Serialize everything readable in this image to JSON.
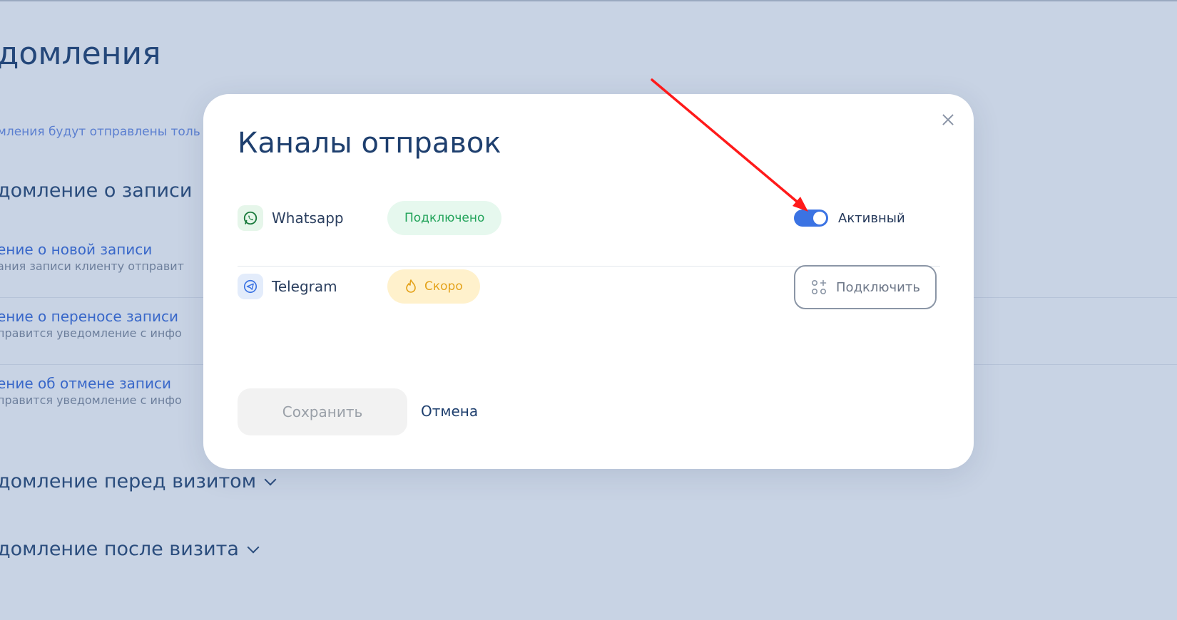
{
  "background_page": {
    "title": "домления",
    "subtitle": "мления будут отправлены толь",
    "section_record": "домление о записи",
    "items": [
      {
        "title": "ение о новой записи",
        "sub": "ания записи клиенту отправит"
      },
      {
        "title": "ение о переносе записи",
        "sub": "правится уведомление с инфо"
      },
      {
        "title": "ение об отмене записи",
        "sub": "правится уведомление с инфо"
      }
    ],
    "section_before": "домление перед визитом",
    "section_after": "домление после визита"
  },
  "modal": {
    "title": "Каналы отправок",
    "channels": [
      {
        "name": "Whatsapp",
        "badge": "Подключено",
        "icon": "whatsapp-icon",
        "toggle_label": "Активный",
        "toggle_on": true
      },
      {
        "name": "Telegram",
        "badge": "Скоро",
        "icon": "telegram-icon",
        "badge_icon": "fire-icon",
        "connect_label": "Подключить"
      }
    ],
    "save_label": "Сохранить",
    "cancel_label": "Отмена"
  },
  "colors": {
    "backdrop": "#c8d3e4",
    "accent": "#3b73e3",
    "success": "#22a35a",
    "warning": "#e4a21a",
    "annotation_arrow": "#ff1a1a"
  }
}
